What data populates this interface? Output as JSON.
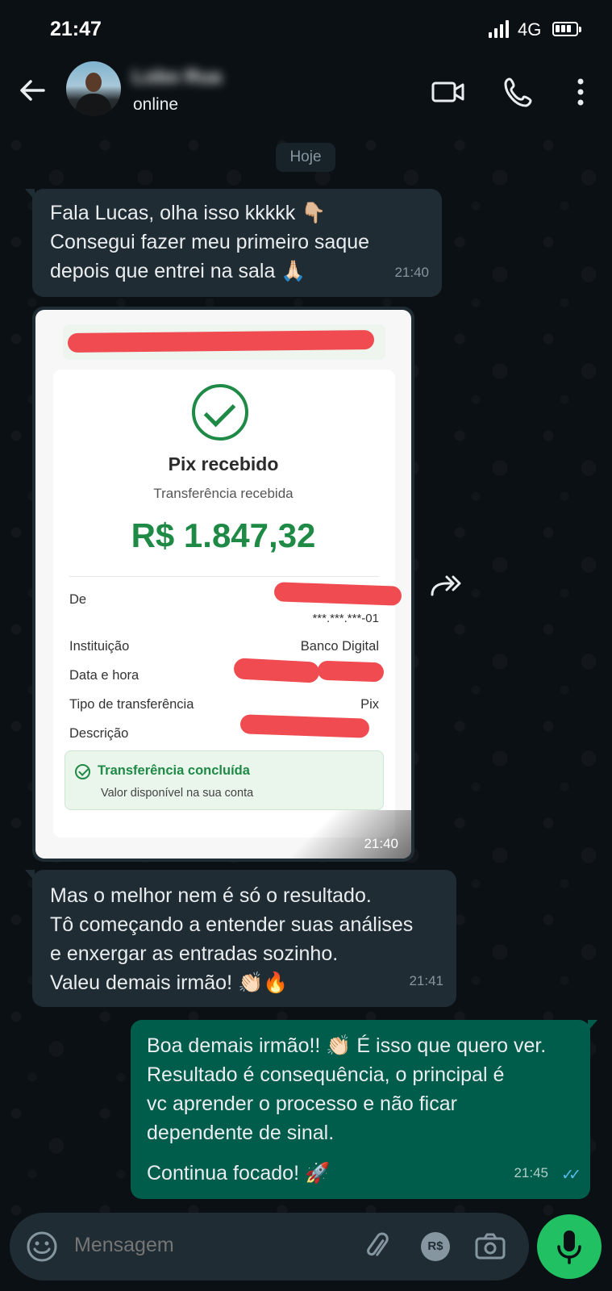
{
  "status_bar": {
    "time": "21:47",
    "network": "4G"
  },
  "header": {
    "contact_name": "Lobo Rua",
    "status": "online"
  },
  "date_chip": "Hoje",
  "messages": [
    {
      "type": "incoming",
      "text": "Fala Lucas, olha isso kkkkk 👇🏼\nConsegui fazer meu primeiro saque\ndepois que entrei na sala 🙏🏻",
      "time": "21:40"
    },
    {
      "type": "incoming-image",
      "time": "21:40"
    },
    {
      "type": "incoming",
      "text": "Mas o melhor nem é só o resultado.\nTô começando a entender suas análises\ne enxergar as entradas sozinho.\nValeu demais irmão! 👏🏻🔥",
      "time": "21:41"
    },
    {
      "type": "outgoing",
      "text": "Boa demais irmão!! 👏🏻 É isso que quero ver.\nResultado é consequência, o principal é\nvc aprender o processo e não ficar\ndependente de sinal.",
      "text2": "Continua focado! 🚀",
      "time": "21:45",
      "ticks": "✓✓"
    }
  ],
  "receipt": {
    "title": "Pix recebido",
    "subtitle": "Transferência recebida",
    "amount": "R$ 1.847,32",
    "rows": [
      {
        "label": "De",
        "value": "***.***.***-01"
      },
      {
        "label": "Instituição",
        "value": "Banco Digital"
      },
      {
        "label": "Data e hora",
        "value": ""
      },
      {
        "label": "Tipo de transferência",
        "value": "Pix"
      },
      {
        "label": "Descrição",
        "value": ""
      }
    ],
    "status_title": "Transferência concluída",
    "status_sub": "Valor disponível na sua conta"
  },
  "input": {
    "placeholder": "Mensagem",
    "currency_button": "R$"
  },
  "colors": {
    "incoming_bubble": "#202c33",
    "outgoing_bubble": "#005c4b",
    "accent_green": "#21c063",
    "receipt_green": "#1e8a46"
  }
}
